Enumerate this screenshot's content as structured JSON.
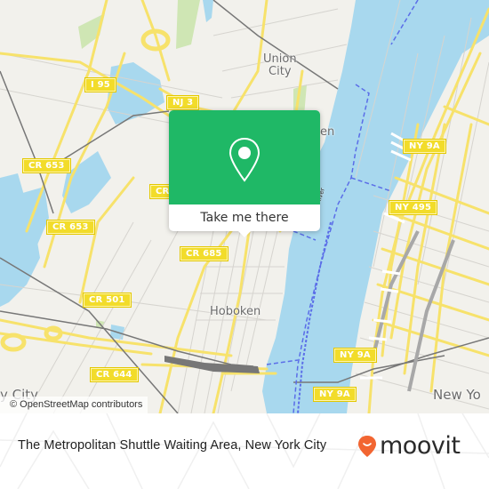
{
  "map": {
    "place_labels": [
      {
        "id": "union-city",
        "text": "Union\nCity"
      },
      {
        "id": "weehawken",
        "text": "en"
      },
      {
        "id": "hoboken",
        "text": "Hoboken"
      },
      {
        "id": "new-york",
        "text": "New Yo"
      },
      {
        "id": "jersey-city",
        "text": "y City"
      }
    ],
    "road_shields": [
      {
        "id": "i95",
        "text": "I 95"
      },
      {
        "id": "nj3",
        "text": "NJ 3"
      },
      {
        "id": "cr653-a",
        "text": "CR 653"
      },
      {
        "id": "cr653-b",
        "text": "CR 653"
      },
      {
        "id": "cr-partial",
        "text": "CR"
      },
      {
        "id": "cr685",
        "text": "CR 685"
      },
      {
        "id": "cr501",
        "text": "CR 501"
      },
      {
        "id": "cr644",
        "text": "CR 644"
      },
      {
        "id": "ny9a-a",
        "text": "NY 9A"
      },
      {
        "id": "ny495",
        "text": "NY 495"
      },
      {
        "id": "ny9a-b",
        "text": "NY 9A"
      },
      {
        "id": "ny9a-c",
        "text": "NY 9A"
      }
    ],
    "river_label": "Hudson River",
    "attribution": "© OpenStreetMap contributors",
    "colors": {
      "land": "#f2f1ec",
      "water": "#a8d8ee",
      "major_road": "#f7e26b",
      "ferry": "#5b6ee8",
      "park": "#cfe6b4",
      "rail": "#777777"
    }
  },
  "popup": {
    "pin_icon": "map-pin-icon",
    "button_label": "Take me there",
    "accent_color": "#1fb866"
  },
  "footer": {
    "caption": "The Metropolitan Shuttle Waiting Area, New York City",
    "brand": "moovit",
    "brand_color": "#f26531"
  }
}
